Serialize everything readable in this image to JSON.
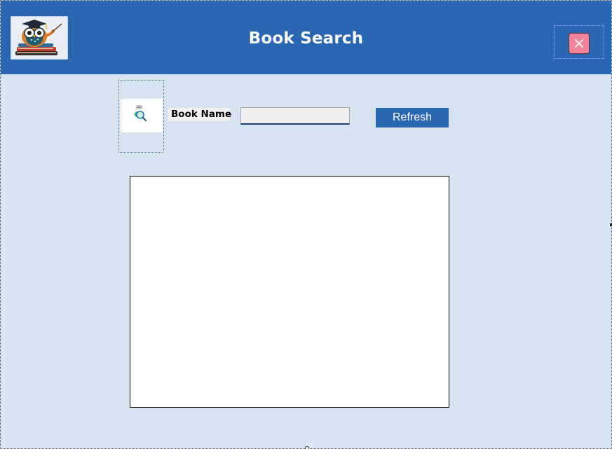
{
  "window": {
    "title": "Book Search"
  },
  "header": {
    "logo_icon": "owl-professor-books-icon",
    "close_icon": "close-x-icon"
  },
  "search": {
    "icon": "book-search-icon",
    "label": "Book Name",
    "value": "",
    "placeholder": "",
    "refresh_label": "Refresh"
  },
  "results": {
    "rows": []
  },
  "colors": {
    "header_bg": "#2a67b2",
    "body_bg": "#d7e4f2",
    "close_bg": "#f2849a",
    "button_bg": "#2a67b2"
  }
}
